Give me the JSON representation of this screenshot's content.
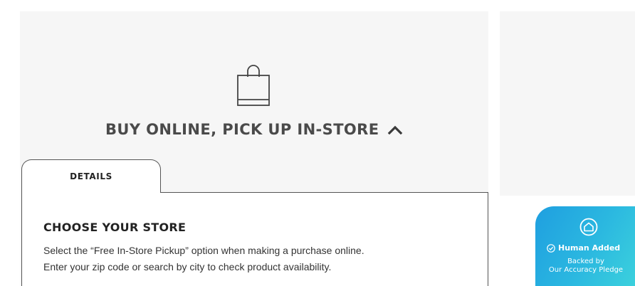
{
  "bopis": {
    "title": "BUY ONLINE, PICK UP IN-STORE",
    "icons": {
      "bag": "shopping-bag-icon",
      "toggle": "chevron-up-icon"
    }
  },
  "tabs": {
    "details_label": "DETAILS"
  },
  "store": {
    "heading": "CHOOSE YOUR STORE",
    "line1": "Select the “Free In-Store Pickup” option when making a purchase online.",
    "line2": "Enter your zip code or search by city to check product availability."
  },
  "badge": {
    "title": "Human Added",
    "sub1": "Backed by",
    "sub2": "Our Accuracy Pledge",
    "colors": {
      "start": "#1f9fe0",
      "end": "#3fd6dc"
    }
  },
  "colors": {
    "panel_bg": "#f6f6f6",
    "title_text": "#4a4a4a",
    "border": "#555555"
  }
}
